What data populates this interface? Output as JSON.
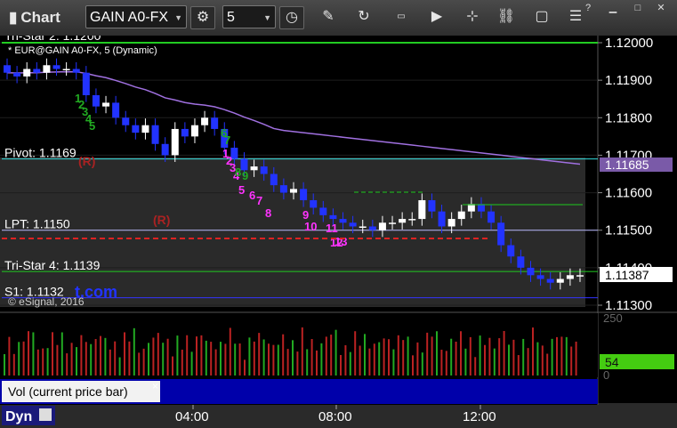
{
  "toolbar": {
    "title": "Chart",
    "symbol": "GAIN A0-FX",
    "interval": "5",
    "help": "?"
  },
  "chart": {
    "series_label": "* EUR@GAIN A0-FX, 5 (Dynamic)",
    "copyright": "© eSignal, 2016",
    "watermark": "t.com",
    "price_axis": [
      "1.12000",
      "1.11900",
      "1.11800",
      "1.11700",
      "1.11600",
      "1.11500",
      "1.11400",
      "1.11300"
    ],
    "current_price": "1.11387",
    "ma_price": "1.11685",
    "levels": [
      {
        "name": "tristar2",
        "label": "Tri-Star 2: 1.1200",
        "price": 1.12,
        "color": "#22cc22"
      },
      {
        "name": "pivot",
        "label": "Pivot: 1.1169",
        "price": 1.1169,
        "color": "#33dddd"
      },
      {
        "name": "lpt",
        "label": "LPT: 1.1150",
        "price": 1.115,
        "color": "#bbbbff"
      },
      {
        "name": "tristar4",
        "label": "Tri-Star 4: 1.1139",
        "price": 1.1139,
        "color": "#22cc22"
      },
      {
        "name": "s1",
        "label": "S1: 1.1132",
        "price": 1.1132,
        "color": "#3333ff"
      }
    ],
    "r_markers": [
      "(R)",
      "(R)"
    ],
    "td_counts_magenta": [
      "1",
      "2",
      "3",
      "4",
      "5",
      "6",
      "7",
      "8",
      "9",
      "10",
      "11",
      "12",
      "13"
    ],
    "td_counts_green": [
      "1",
      "2",
      "3",
      "4",
      "5",
      "6",
      "7",
      "8",
      "9"
    ],
    "time_axis": [
      "04:00",
      "08:00",
      "12:00"
    ],
    "colors": {
      "ma": "#a070e0",
      "up": "#ffffff",
      "down": "#2233ff",
      "bg": "#000000"
    }
  },
  "volume": {
    "label": "Vol (current price bar)",
    "close_icon": "×",
    "axis": [
      "250",
      "0"
    ],
    "current": "54"
  },
  "footer": {
    "dyn": "Dyn"
  },
  "chart_data": {
    "type": "candlestick",
    "series_label": "EUR@GAIN A0-FX, 5 (Dynamic)",
    "x_ticks": [
      "04:00",
      "08:00",
      "12:00"
    ],
    "ylim": [
      1.1128,
      1.1205
    ],
    "closes": [
      1.1192,
      1.1191,
      1.1193,
      1.1192,
      1.1194,
      1.1193,
      1.1193,
      1.1192,
      1.1186,
      1.1183,
      1.1184,
      1.118,
      1.1178,
      1.1176,
      1.1178,
      1.1173,
      1.117,
      1.1177,
      1.1175,
      1.1178,
      1.118,
      1.1177,
      1.1172,
      1.1169,
      1.1166,
      1.1167,
      1.1165,
      1.1162,
      1.116,
      1.1161,
      1.1158,
      1.1156,
      1.1154,
      1.1153,
      1.1152,
      1.1151,
      1.1151,
      1.115,
      1.1152,
      1.1152,
      1.1153,
      1.1153,
      1.1158,
      1.1155,
      1.1151,
      1.1153,
      1.1155,
      1.1157,
      1.1155,
      1.1152,
      1.1146,
      1.1143,
      1.114,
      1.1138,
      1.1137,
      1.1136,
      1.1137,
      1.1138,
      1.1138
    ],
    "volume_current": 54,
    "volume_axis": [
      0,
      250
    ]
  }
}
